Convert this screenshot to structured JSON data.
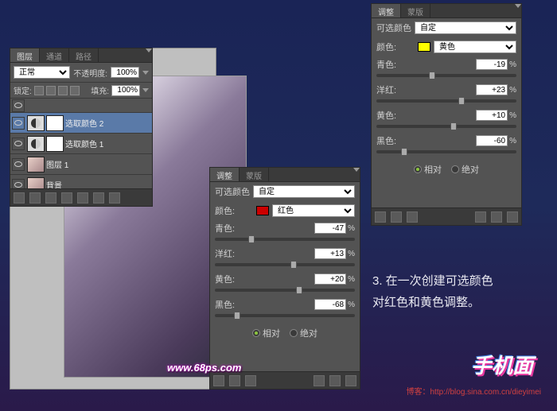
{
  "layers_panel": {
    "tabs": [
      "图层",
      "通道",
      "路径"
    ],
    "mode": "正常",
    "opacity_label": "不透明度:",
    "opacity": "100%",
    "lock_label": "锁定:",
    "fill_label": "填充:",
    "fill": "100%",
    "items": [
      {
        "name": "选取颜色 2",
        "selected": true,
        "type": "adj"
      },
      {
        "name": "选取颜色 1",
        "selected": false,
        "type": "adj"
      },
      {
        "name": "图层 1",
        "selected": false,
        "type": "face"
      },
      {
        "name": "背景",
        "selected": false,
        "type": "face"
      }
    ]
  },
  "adj_common": {
    "tabs": [
      "调整",
      "蒙版"
    ],
    "preset_label": "可选颜色",
    "preset": "自定",
    "color_label": "颜色:",
    "cyan": "青色:",
    "magenta": "洋红:",
    "yellow": "黄色:",
    "black": "黑色:",
    "mode_rel": "相对",
    "mode_abs": "绝对"
  },
  "adj1": {
    "color_name": "红色",
    "swatch": "sw-red",
    "cyan": "-47",
    "magenta": "+13",
    "yellow": "+20",
    "black": "-68"
  },
  "adj2": {
    "color_name": "黄色",
    "swatch": "sw-yel",
    "cyan": "-19",
    "magenta": "+23",
    "yellow": "+10",
    "black": "-60"
  },
  "instruction": {
    "line1": "3. 在一次创建可选颜色",
    "line2": "对红色和黄色调整。"
  },
  "watermark": "www.68ps.com",
  "logo": "手机面",
  "credit_label": "博客：",
  "credit_url": "http://blog.sina.com.cn/dieyimei",
  "chart_data": [
    {
      "type": "table",
      "title": "可选颜色 红色",
      "rows": [
        [
          "青色",
          -47
        ],
        [
          "洋红",
          13
        ],
        [
          "黄色",
          20
        ],
        [
          "黑色",
          -68
        ]
      ],
      "mode": "相对"
    },
    {
      "type": "table",
      "title": "可选颜色 黄色",
      "rows": [
        [
          "青色",
          -19
        ],
        [
          "洋红",
          23
        ],
        [
          "黄色",
          10
        ],
        [
          "黑色",
          -60
        ]
      ],
      "mode": "相对"
    }
  ]
}
